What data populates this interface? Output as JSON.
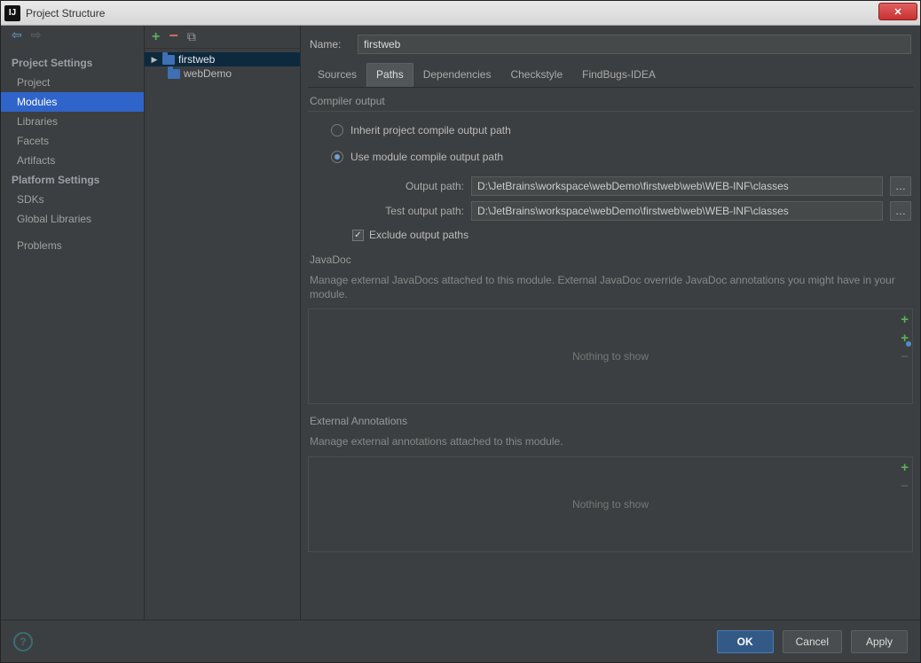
{
  "window": {
    "title": "Project Structure"
  },
  "left": {
    "section1": "Project Settings",
    "items1": [
      "Project",
      "Modules",
      "Libraries",
      "Facets",
      "Artifacts"
    ],
    "selected1": "Modules",
    "section2": "Platform Settings",
    "items2": [
      "SDKs",
      "Global Libraries"
    ],
    "section3": "",
    "items3": [
      "Problems"
    ]
  },
  "tree": {
    "root": "firstweb",
    "child": "webDemo"
  },
  "main": {
    "name_label": "Name:",
    "name_value": "firstweb",
    "tabs": [
      "Sources",
      "Paths",
      "Dependencies",
      "Checkstyle",
      "FindBugs-IDEA"
    ],
    "active_tab": "Paths",
    "compiler": {
      "heading": "Compiler output",
      "radio_inherit": "Inherit project compile output path",
      "radio_module": "Use module compile output path",
      "output_label": "Output path:",
      "output_value": "D:\\JetBrains\\workspace\\webDemo\\firstweb\\web\\WEB-INF\\classes",
      "test_label": "Test output path:",
      "test_value": "D:\\JetBrains\\workspace\\webDemo\\firstweb\\web\\WEB-INF\\classes",
      "exclude_label": "Exclude output paths"
    },
    "javadoc": {
      "heading": "JavaDoc",
      "desc": "Manage external JavaDocs attached to this module. External JavaDoc override JavaDoc annotations you might have in your module.",
      "empty": "Nothing to show"
    },
    "extann": {
      "heading": "External Annotations",
      "desc": "Manage external annotations attached to this module.",
      "empty": "Nothing to show"
    }
  },
  "footer": {
    "ok": "OK",
    "cancel": "Cancel",
    "apply": "Apply"
  }
}
